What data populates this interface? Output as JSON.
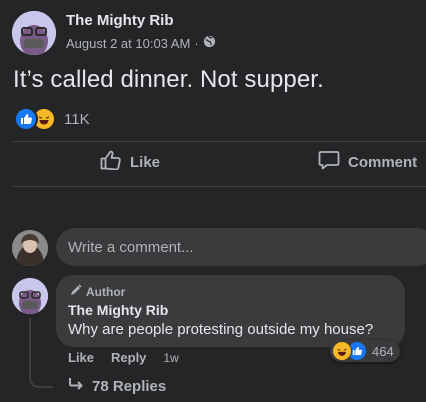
{
  "post": {
    "page_name": "The Mighty Rib",
    "timestamp": "August 2 at 10:03 AM",
    "separator": "·",
    "text": "It’s called dinner. Not supper.",
    "reaction_count": "11K"
  },
  "actions": {
    "like_label": "Like",
    "comment_label": "Comment"
  },
  "composer": {
    "placeholder": "Write a comment..."
  },
  "comment": {
    "badge": "Author",
    "author": "The Mighty Rib",
    "text": "Why are people protesting outside my house?",
    "reaction_count": "464",
    "like_label": "Like",
    "reply_label": "Reply",
    "time": "1w",
    "replies_label": "78 Replies"
  },
  "colors": {
    "background": "#242526",
    "bubble": "#3a3b3c",
    "like_blue": "#1877f2",
    "haha_yellow": "#f7b928",
    "text_primary": "#e4e6eb",
    "text_secondary": "#b0b3b8"
  }
}
